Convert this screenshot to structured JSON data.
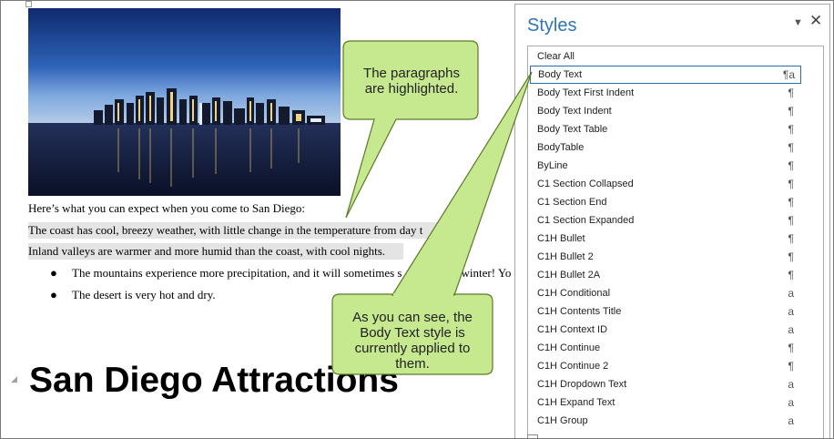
{
  "document": {
    "intro": "Here’s what you can expect when you come to San Diego:",
    "para_coast": "The coast has cool, breezy weather, with little change in the temperature from day t",
    "para_inland": "Inland valleys are warmer and more humid than the coast, with cool nights.",
    "bullets": [
      "The mountains experience more precipitation, and it will sometimes s",
      "The desert is very hot and dry."
    ],
    "bullet_tail": "he winter! Yo",
    "heading": "San Diego Attractions"
  },
  "callouts": {
    "top": "The paragraphs are highlighted.",
    "bottom": "As you can see, the Body Text style is currently applied to them."
  },
  "styles_pane": {
    "title": "Styles",
    "clear_all": "Clear All",
    "items": [
      {
        "label": "Body Text",
        "mark": "¶a",
        "selected": true
      },
      {
        "label": "Body Text First Indent",
        "mark": "¶"
      },
      {
        "label": "Body Text Indent",
        "mark": "¶"
      },
      {
        "label": "Body Text Table",
        "mark": "¶"
      },
      {
        "label": "BodyTable",
        "mark": "¶"
      },
      {
        "label": "ByLine",
        "mark": "¶"
      },
      {
        "label": "C1 Section Collapsed",
        "mark": "¶"
      },
      {
        "label": "C1 Section End",
        "mark": "¶"
      },
      {
        "label": "C1 Section Expanded",
        "mark": "¶"
      },
      {
        "label": "C1H Bullet",
        "mark": "¶"
      },
      {
        "label": "C1H Bullet 2",
        "mark": "¶"
      },
      {
        "label": "C1H Bullet 2A",
        "mark": "¶"
      },
      {
        "label": "C1H Conditional",
        "mark": "a"
      },
      {
        "label": "C1H Contents Title",
        "mark": "a"
      },
      {
        "label": "C1H Context ID",
        "mark": "a"
      },
      {
        "label": "C1H Continue",
        "mark": "¶"
      },
      {
        "label": "C1H Continue 2",
        "mark": "¶"
      },
      {
        "label": "C1H Dropdown Text",
        "mark": "a"
      },
      {
        "label": "C1H Expand Text",
        "mark": "a"
      },
      {
        "label": "C1H Group",
        "mark": "a"
      }
    ]
  },
  "colors": {
    "callout_fill": "#c6e88f",
    "callout_stroke": "#5a7a2a",
    "pane_title": "#2e75b6"
  },
  "icons": {
    "dropdown": "chevron-down-icon",
    "close": "close-icon",
    "paragraph_mark": "paragraph-mark-icon",
    "character_mark": "character-mark-icon"
  }
}
